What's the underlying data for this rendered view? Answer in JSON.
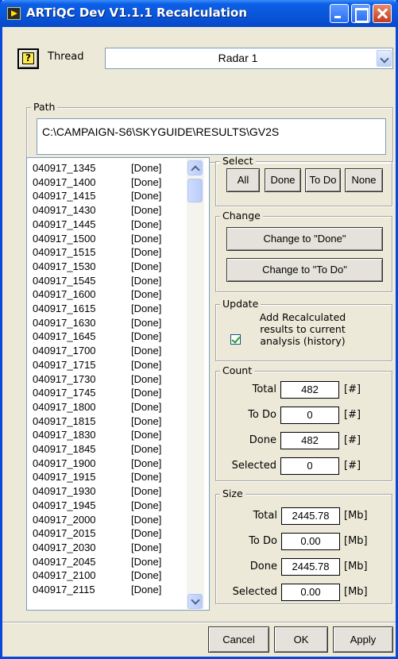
{
  "window": {
    "title": "ARTiQC Dev V1.1.1 Recalculation"
  },
  "thread": {
    "label": "Thread",
    "value": "Radar 1"
  },
  "path": {
    "label": "Path",
    "value": "C:\\CAMPAIGN-S6\\SKYGUIDE\\RESULTS\\GV2S"
  },
  "list": {
    "items": [
      {
        "id": "040917_1345",
        "status": "[Done]"
      },
      {
        "id": "040917_1400",
        "status": "[Done]"
      },
      {
        "id": "040917_1415",
        "status": "[Done]"
      },
      {
        "id": "040917_1430",
        "status": "[Done]"
      },
      {
        "id": "040917_1445",
        "status": "[Done]"
      },
      {
        "id": "040917_1500",
        "status": "[Done]"
      },
      {
        "id": "040917_1515",
        "status": "[Done]"
      },
      {
        "id": "040917_1530",
        "status": "[Done]"
      },
      {
        "id": "040917_1545",
        "status": "[Done]"
      },
      {
        "id": "040917_1600",
        "status": "[Done]"
      },
      {
        "id": "040917_1615",
        "status": "[Done]"
      },
      {
        "id": "040917_1630",
        "status": "[Done]"
      },
      {
        "id": "040917_1645",
        "status": "[Done]"
      },
      {
        "id": "040917_1700",
        "status": "[Done]"
      },
      {
        "id": "040917_1715",
        "status": "[Done]"
      },
      {
        "id": "040917_1730",
        "status": "[Done]"
      },
      {
        "id": "040917_1745",
        "status": "[Done]"
      },
      {
        "id": "040917_1800",
        "status": "[Done]"
      },
      {
        "id": "040917_1815",
        "status": "[Done]"
      },
      {
        "id": "040917_1830",
        "status": "[Done]"
      },
      {
        "id": "040917_1845",
        "status": "[Done]"
      },
      {
        "id": "040917_1900",
        "status": "[Done]"
      },
      {
        "id": "040917_1915",
        "status": "[Done]"
      },
      {
        "id": "040917_1930",
        "status": "[Done]"
      },
      {
        "id": "040917_1945",
        "status": "[Done]"
      },
      {
        "id": "040917_2000",
        "status": "[Done]"
      },
      {
        "id": "040917_2015",
        "status": "[Done]"
      },
      {
        "id": "040917_2030",
        "status": "[Done]"
      },
      {
        "id": "040917_2045",
        "status": "[Done]"
      },
      {
        "id": "040917_2100",
        "status": "[Done]"
      },
      {
        "id": "040917_2115",
        "status": "[Done]"
      }
    ]
  },
  "select": {
    "label": "Select",
    "all": "All",
    "done": "Done",
    "todo": "To Do",
    "none": "None"
  },
  "change": {
    "label": "Change",
    "to_done": "Change to \"Done\"",
    "to_todo": "Change to \"To Do\""
  },
  "update": {
    "label": "Update",
    "checkbox_label": "Add Recalculated results to current analysis (history)",
    "checked": true
  },
  "count": {
    "label": "Count",
    "rows": [
      {
        "label": "Total",
        "value": "482",
        "unit": "[#]"
      },
      {
        "label": "To Do",
        "value": "0",
        "unit": "[#]"
      },
      {
        "label": "Done",
        "value": "482",
        "unit": "[#]"
      },
      {
        "label": "Selected",
        "value": "0",
        "unit": "[#]"
      }
    ]
  },
  "size": {
    "label": "Size",
    "rows": [
      {
        "label": "Total",
        "value": "2445.78",
        "unit": "[Mb]"
      },
      {
        "label": "To Do",
        "value": "0.00",
        "unit": "[Mb]"
      },
      {
        "label": "Done",
        "value": "2445.78",
        "unit": "[Mb]"
      },
      {
        "label": "Selected",
        "value": "0.00",
        "unit": "[Mb]"
      }
    ]
  },
  "footer": {
    "cancel": "Cancel",
    "ok": "OK",
    "apply": "Apply"
  },
  "colors": {
    "titlebar": "#0a55d9",
    "window_bg": "#ece9d8",
    "check": "#21a121"
  }
}
